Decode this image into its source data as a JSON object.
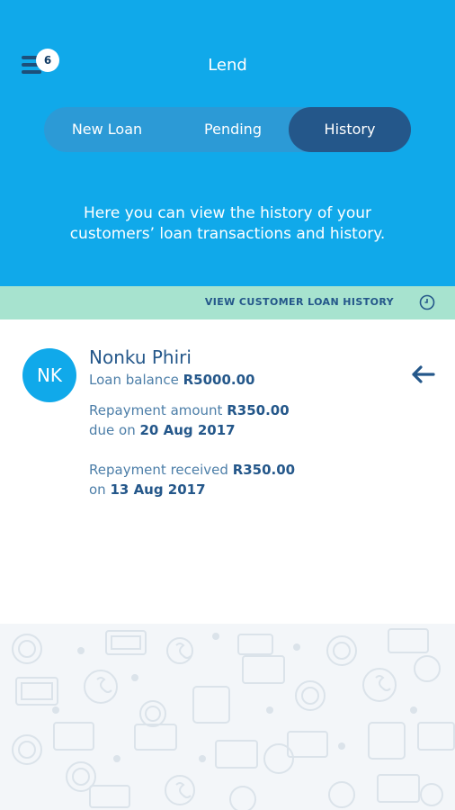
{
  "header": {
    "title": "Lend",
    "menu_badge": "6",
    "tabs": [
      {
        "label": "New Loan",
        "active": false
      },
      {
        "label": "Pending",
        "active": false
      },
      {
        "label": "History",
        "active": true
      }
    ],
    "intro_line1": "Here you can view the history of your",
    "intro_line2": "customers’ loan transactions and history."
  },
  "history_strip": {
    "label": "VIEW CUSTOMER LOAN HISTORY",
    "icon": "clock-icon"
  },
  "customer": {
    "initials": "NK",
    "name": "Nonku Phiri",
    "loan_balance_label": "Loan balance",
    "loan_balance_value": "R5000.00",
    "repayment_amount_label": "Repayment amount",
    "repayment_amount_value": "R350.00",
    "due_on_label": "due on",
    "due_on_value": "20 Aug 2017",
    "repayment_received_label": "Repayment received",
    "repayment_received_value": "R350.00",
    "received_on_label": "on",
    "received_on_value": "13 Aug 2017"
  },
  "colors": {
    "header_bg": "#10a9ea",
    "tab_track": "#2c9ad6",
    "tab_active": "#24578a",
    "strip_bg": "#a7e3cf",
    "text_dark": "#24578a",
    "text_muted": "#4c7ea8"
  }
}
